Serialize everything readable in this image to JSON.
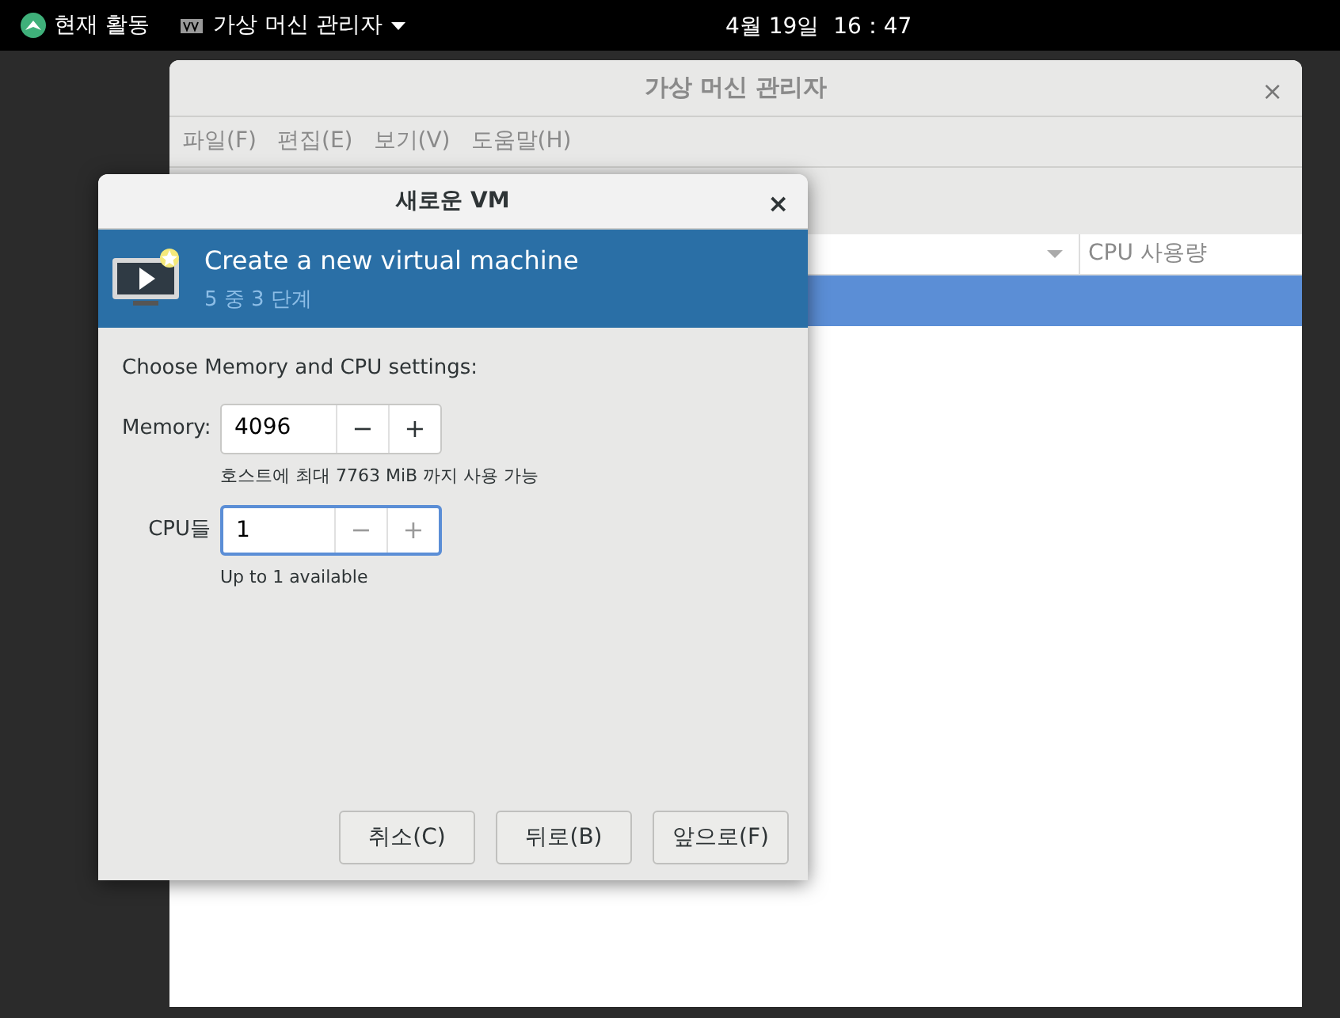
{
  "top_bar": {
    "activities": "현재 활동",
    "app_menu": "가상 머신 관리자",
    "clock": "4월 19일  16：47"
  },
  "main_window": {
    "title": "가상 머신 관리자",
    "close": "×",
    "menu": [
      "파일(F)",
      "편집(E)",
      "보기(V)",
      "도움말(H)"
    ],
    "columns": [
      "CPU 사용량"
    ],
    "rows": [
      {
        "selected": true
      }
    ]
  },
  "dialog": {
    "title": "새로운 VM",
    "close": "×",
    "header": {
      "title": "Create a new virtual machine",
      "step": "5 중 3 단계"
    },
    "instruction": "Choose Memory and CPU settings:",
    "fields": [
      {
        "label": "Memory:",
        "value": "4096",
        "focused": false,
        "minus": "−",
        "plus": "+",
        "minus_disabled": false,
        "plus_disabled": false,
        "hint": "호스트에 최대 7763 MiB 까지 사용 가능"
      },
      {
        "label": "CPU들",
        "value": "1",
        "focused": true,
        "minus": "−",
        "plus": "+",
        "minus_disabled": true,
        "plus_disabled": true,
        "hint": "Up to 1 available"
      }
    ],
    "buttons": [
      "취소(C)",
      "뒤로(B)",
      "앞으로(F)"
    ]
  }
}
